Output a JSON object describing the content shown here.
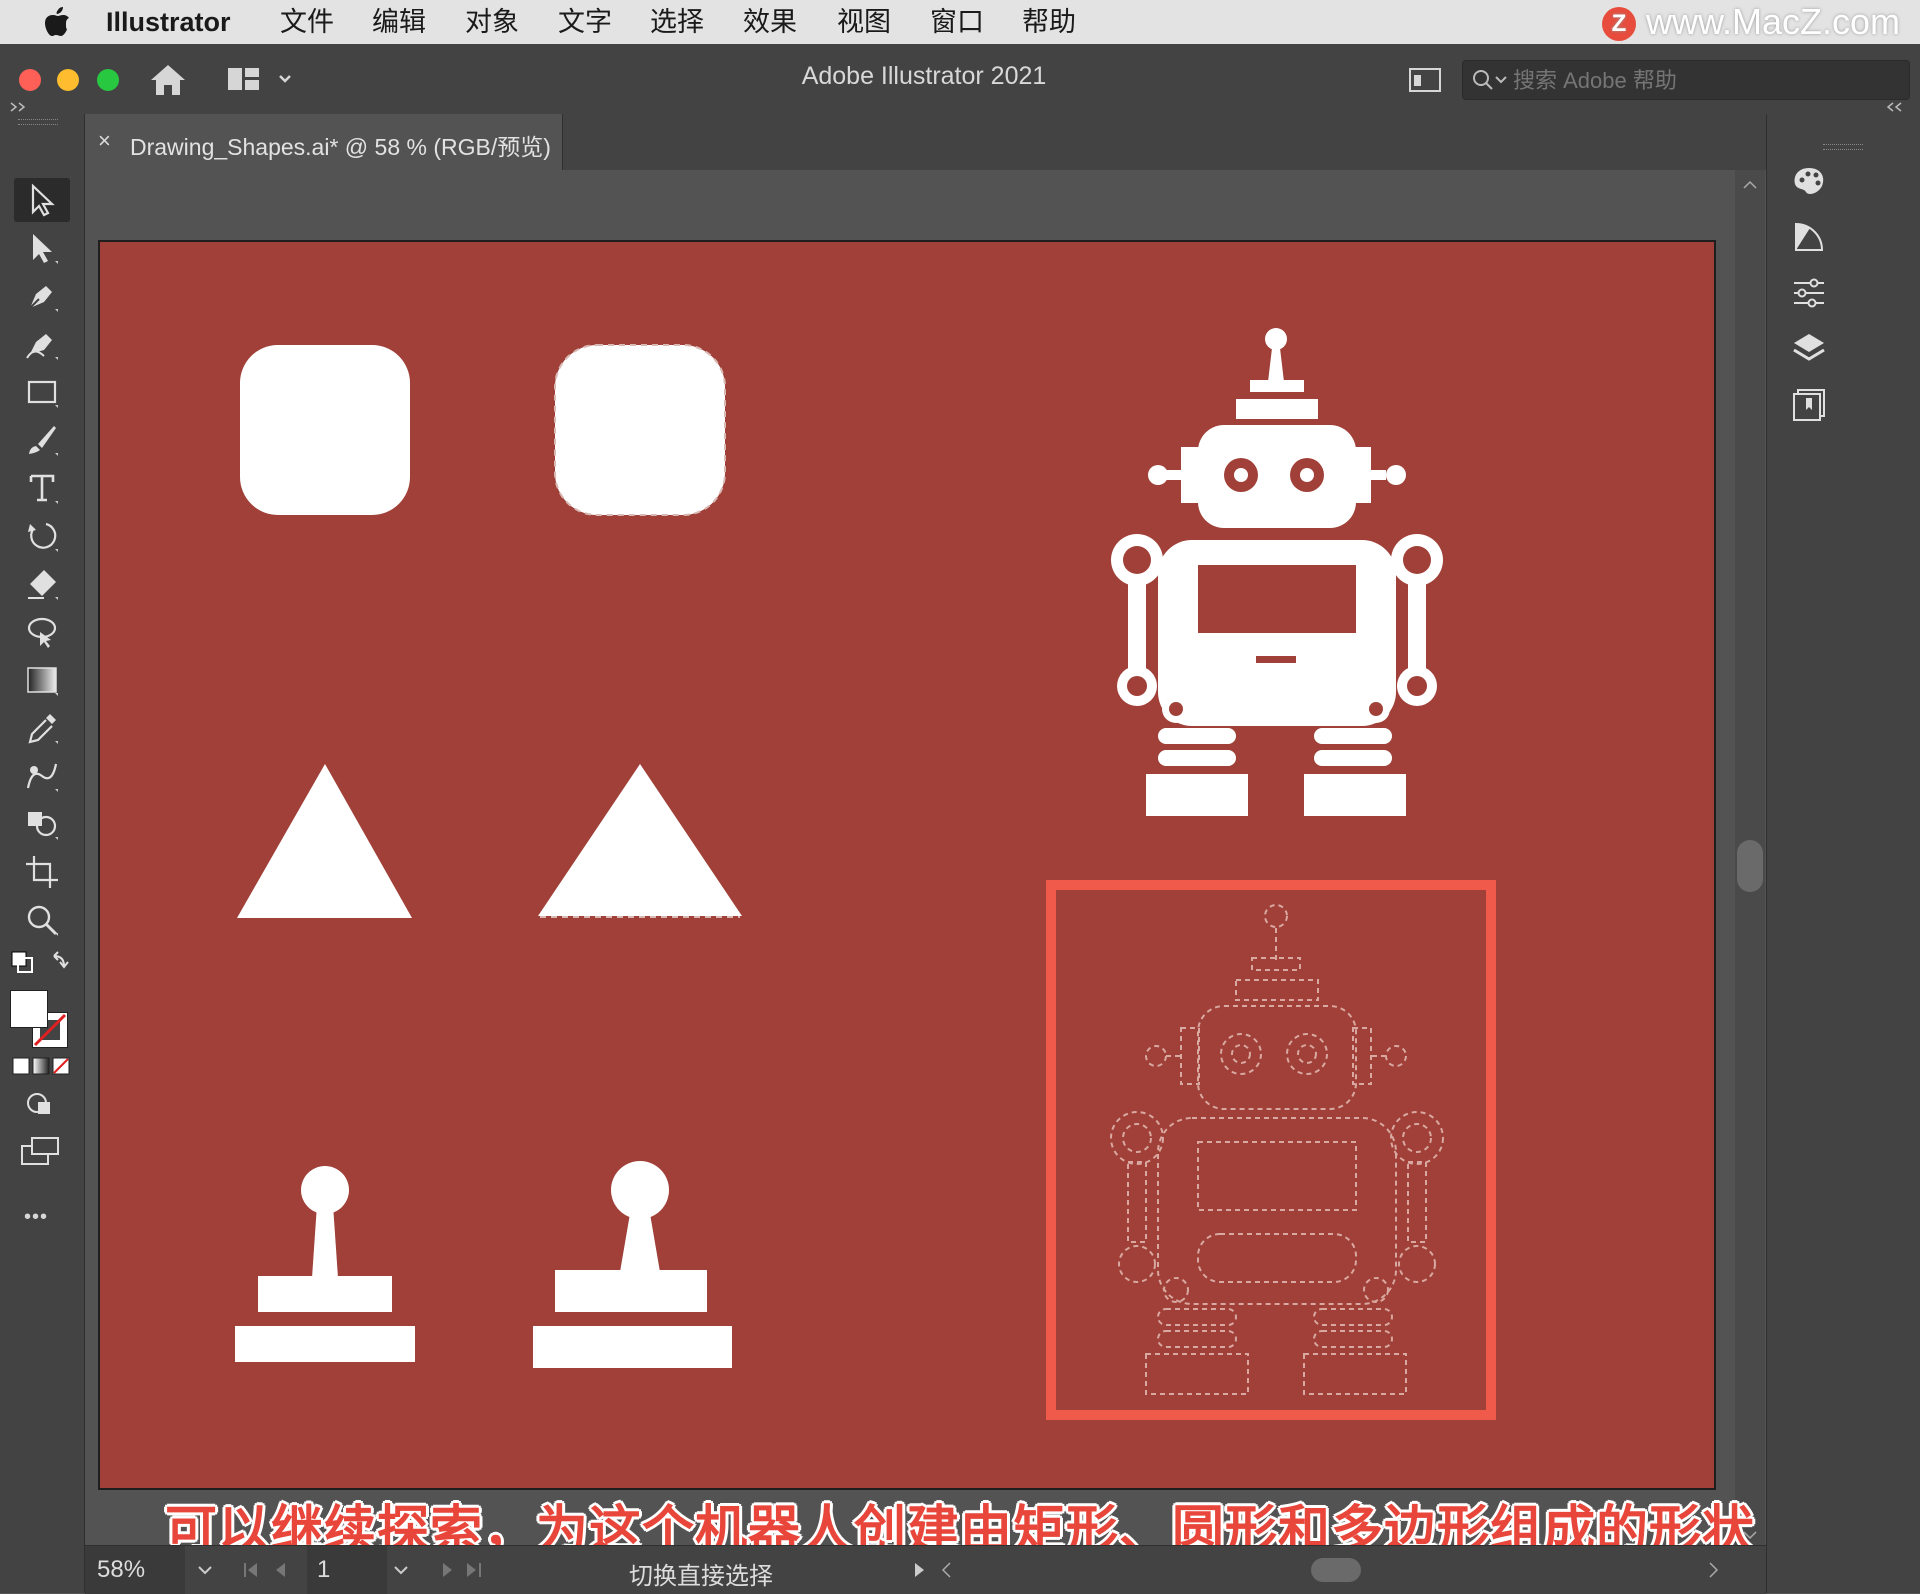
{
  "menubar": {
    "app_name": "Illustrator",
    "items": [
      "文件",
      "编辑",
      "对象",
      "文字",
      "选择",
      "效果",
      "视图",
      "窗口",
      "帮助"
    ],
    "watermark": "www.MacZ.com",
    "watermark_logo": "Z"
  },
  "appbar": {
    "title": "Adobe Illustrator 2021",
    "search_placeholder": "搜索 Adobe 帮助",
    "traffic_lights": {
      "close": "#fe5f57",
      "minimize": "#febc2e",
      "zoom": "#28c840"
    }
  },
  "document": {
    "tab_close": "×",
    "tab_title": "Drawing_Shapes.ai* @ 58 % (RGB/预览)"
  },
  "artboard": {
    "background": "#a04038",
    "highlight_color": "#f05a4b"
  },
  "toolbar": {
    "tools": [
      "selection-tool",
      "direct-selection-tool",
      "pen-tool",
      "curvature-tool",
      "rectangle-tool",
      "paintbrush-tool",
      "type-tool",
      "rotate-tool",
      "eraser-tool",
      "lasso-tool",
      "gradient-tool",
      "eyedropper-tool",
      "blend-tool",
      "shape-builder-tool",
      "artboard-tool",
      "zoom-tool"
    ],
    "more": "•••"
  },
  "right_panel": {
    "panels": [
      "color-panel-icon",
      "color-guide-icon",
      "properties-icon",
      "layers-icon",
      "libraries-icon"
    ]
  },
  "statusbar": {
    "zoom": "58%",
    "artboard_number": "1",
    "status_text": "切换直接选择"
  },
  "subtitle": "可以继续探索，为这个机器人创建由矩形、圆形和多边形组成的形状"
}
